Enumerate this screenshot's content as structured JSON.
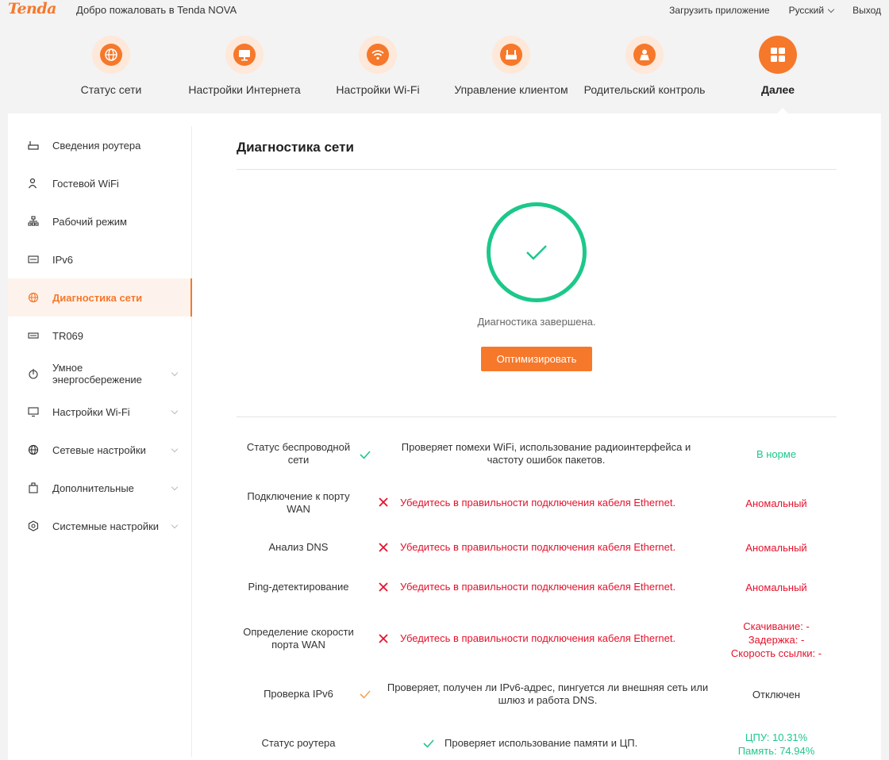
{
  "header": {
    "logo": "Tenda",
    "welcome": "Добро пожаловать в Tenda NOVA",
    "download_app": "Загрузить приложение",
    "language": "Русский",
    "logout": "Выход"
  },
  "nav": [
    {
      "label": "Статус сети",
      "icon": "globe-icon"
    },
    {
      "label": "Настройки Интернета",
      "icon": "monitor-icon"
    },
    {
      "label": "Настройки Wi-Fi",
      "icon": "wifi-icon"
    },
    {
      "label": "Управление клиентом",
      "icon": "router-icon"
    },
    {
      "label": "Родительский контроль",
      "icon": "parent-icon"
    },
    {
      "label": "Далее",
      "icon": "grid-icon",
      "active": true
    }
  ],
  "sidebar": [
    {
      "label": "Сведения роутера",
      "icon": "router-info-icon"
    },
    {
      "label": "Гостевой WiFi",
      "icon": "guest-wifi-icon"
    },
    {
      "label": "Рабочий режим",
      "icon": "work-mode-icon"
    },
    {
      "label": "IPv6",
      "icon": "ipv6-icon"
    },
    {
      "label": "Диагностика сети",
      "icon": "globe-icon",
      "active": true
    },
    {
      "label": "TR069",
      "icon": "tr069-icon"
    },
    {
      "label": "Умное энергосбережение",
      "icon": "energy-icon",
      "expandable": true
    },
    {
      "label": "Настройки Wi-Fi",
      "icon": "wifi-settings-icon",
      "expandable": true
    },
    {
      "label": "Сетевые настройки",
      "icon": "network-icon",
      "expandable": true
    },
    {
      "label": "Дополнительные",
      "icon": "additional-icon",
      "expandable": true
    },
    {
      "label": "Системные настройки",
      "icon": "system-icon",
      "expandable": true
    }
  ],
  "main": {
    "title": "Диагностика сети",
    "completed_text": "Диагностика завершена.",
    "optimize_button": "Оптимизировать",
    "rows": [
      {
        "name": "Статус беспроводной сети",
        "icon": "check-green",
        "description": "Проверяет помехи WiFi, использование радиоинтерфейса и частоту ошибок пакетов.",
        "status": "В норме",
        "status_type": "ok"
      },
      {
        "name": "Подключение к порту WAN",
        "icon": "cross-red",
        "description": "Убедитесь в правильности подключения кабеля Ethernet.",
        "status": "Аномальный",
        "status_type": "bad"
      },
      {
        "name": "Анализ DNS",
        "icon": "cross-red",
        "description": "Убедитесь в правильности подключения кабеля Ethernet.",
        "status": "Аномальный",
        "status_type": "bad"
      },
      {
        "name": "Ping-детектирование",
        "icon": "cross-red",
        "description": "Убедитесь в правильности подключения кабеля Ethernet.",
        "status": "Аномальный",
        "status_type": "bad"
      },
      {
        "name": "Определение скорости порта WAN",
        "icon": "cross-red",
        "description": "Убедитесь в правильности подключения кабеля Ethernet.",
        "status_lines": [
          "Скачивание: -",
          "Задержка: -",
          "Скорость ссылки: -"
        ],
        "status_type": "bad"
      },
      {
        "name": "Проверка IPv6",
        "icon": "check-orange",
        "description": "Проверяет, получен ли IPv6-адрес, пингуется ли внешняя сеть или шлюз и работа DNS.",
        "status": "Отключен",
        "status_type": "off"
      },
      {
        "name": "Статус роутера",
        "icon": "check-green",
        "description": "Проверяет использование памяти и ЦП.",
        "status_lines": [
          "ЦПУ: 10.31%",
          "Память: 74.94%"
        ],
        "status_type": "ok"
      }
    ]
  },
  "colors": {
    "accent": "#f6782b",
    "success": "#1cc88a",
    "error": "#e5122c"
  }
}
